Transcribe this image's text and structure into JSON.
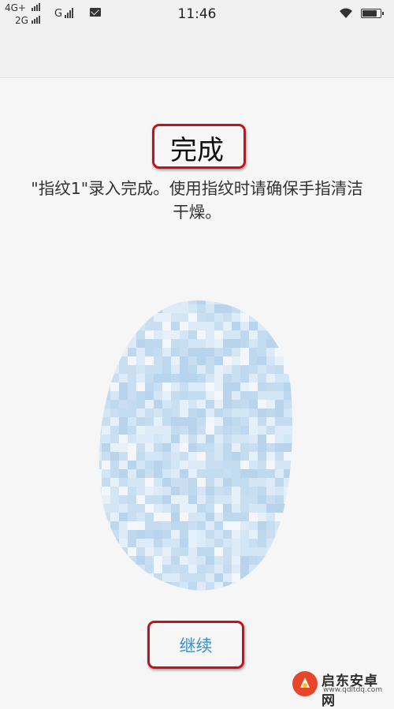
{
  "status_bar": {
    "network_1": "4G+",
    "network_2": "2G",
    "network_3": "G",
    "time": "11:46",
    "battery_level": 0.9,
    "icons": [
      "signal-bars-icon",
      "mail-icon",
      "wifi-icon",
      "battery-icon"
    ]
  },
  "main": {
    "title": "完成",
    "message": "\"指纹1\"录入完成。使用指纹时请确保手指清洁干燥。",
    "continue_label": "继续"
  },
  "watermark": {
    "brand": "启东安卓网",
    "url": "www.qdltdq.com"
  },
  "colors": {
    "background": "#f6f6f6",
    "header": "#f1f1f1",
    "accent": "#3a8fd0",
    "highlight_border": "#c8101a",
    "fingerprint": "#cfe3f3"
  }
}
